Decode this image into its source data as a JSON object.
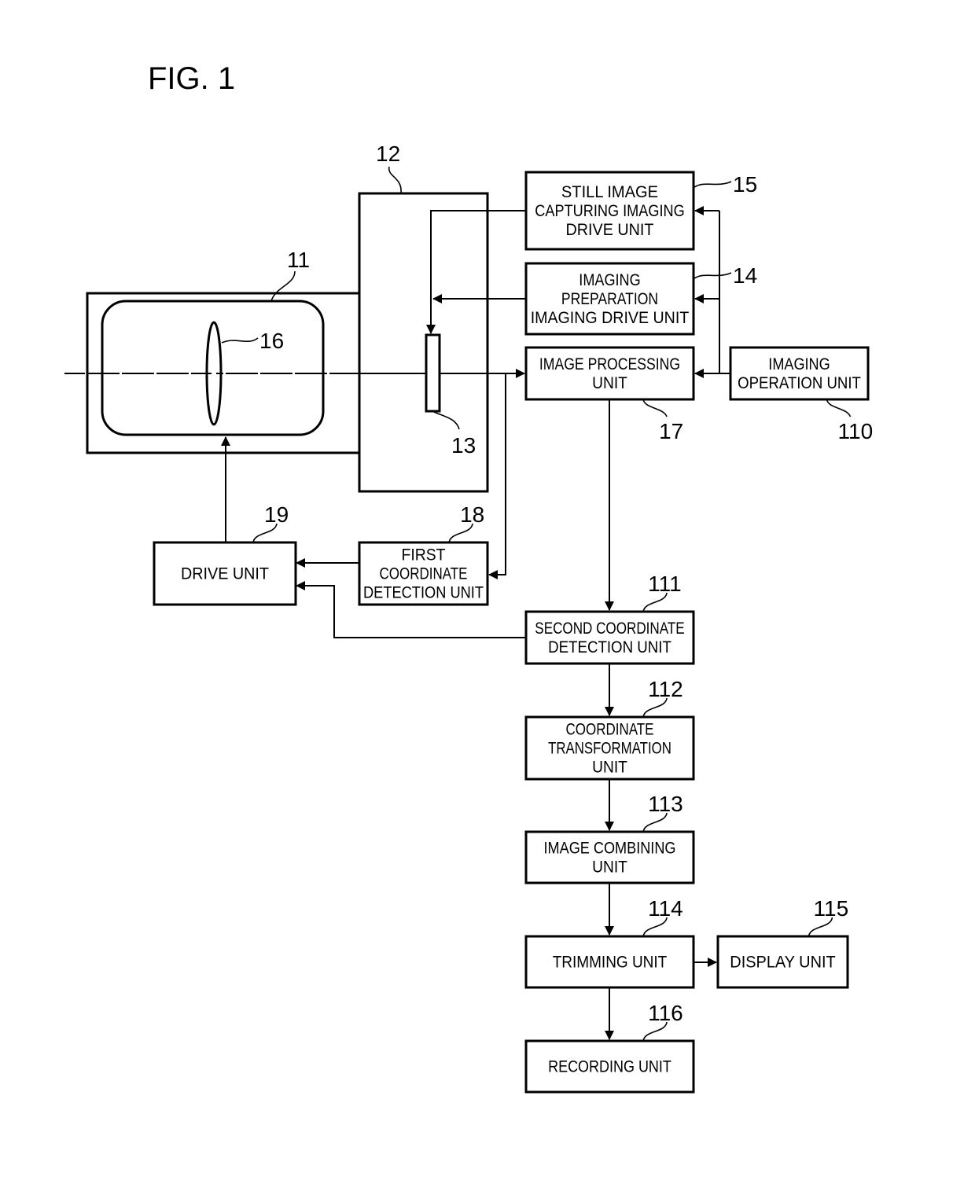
{
  "figure": {
    "title": "FIG. 1"
  },
  "blocks": {
    "b15": {
      "ref": "15",
      "lines": [
        "STILL IMAGE",
        "CAPTURING IMAGING",
        "DRIVE UNIT"
      ]
    },
    "b14": {
      "ref": "14",
      "lines": [
        "IMAGING",
        "PREPARATION",
        "IMAGING DRIVE UNIT"
      ]
    },
    "b17": {
      "ref": "17",
      "lines": [
        "IMAGE PROCESSING",
        "UNIT"
      ]
    },
    "b110": {
      "ref": "110",
      "lines": [
        "IMAGING",
        "OPERATION UNIT"
      ]
    },
    "b19": {
      "ref": "19",
      "lines": [
        "DRIVE UNIT"
      ]
    },
    "b18": {
      "ref": "18",
      "lines": [
        "FIRST",
        "COORDINATE",
        "DETECTION UNIT"
      ]
    },
    "b111": {
      "ref": "111",
      "lines": [
        "SECOND COORDINATE",
        "DETECTION UNIT"
      ]
    },
    "b112": {
      "ref": "112",
      "lines": [
        "COORDINATE",
        "TRANSFORMATION",
        "UNIT"
      ]
    },
    "b113": {
      "ref": "113",
      "lines": [
        "IMAGE COMBINING",
        "UNIT"
      ]
    },
    "b114": {
      "ref": "114",
      "lines": [
        "TRIMMING UNIT"
      ]
    },
    "b115": {
      "ref": "115",
      "lines": [
        "DISPLAY UNIT"
      ]
    },
    "b116": {
      "ref": "116",
      "lines": [
        "RECORDING UNIT"
      ]
    }
  },
  "components": {
    "lens_barrel": {
      "ref": "11"
    },
    "camera_body": {
      "ref": "12"
    },
    "image_sensor": {
      "ref": "13"
    },
    "lens": {
      "ref": "16"
    }
  }
}
